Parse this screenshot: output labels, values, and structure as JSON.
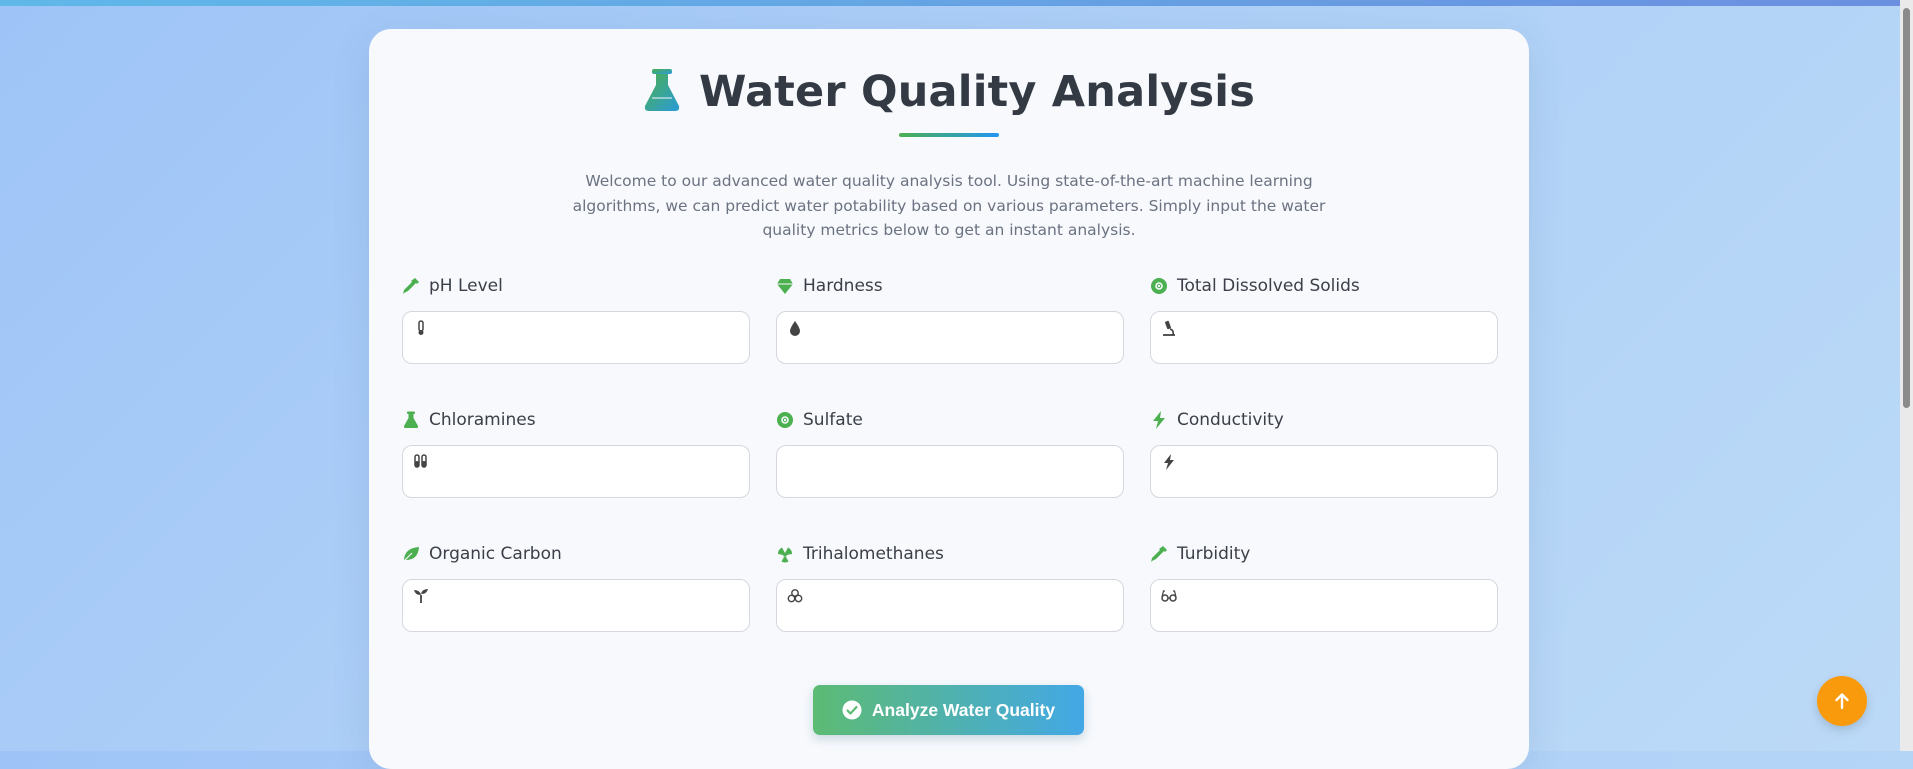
{
  "page": {
    "title": "Water Quality Analysis",
    "intro": "Welcome to our advanced water quality analysis tool. Using state-of-the-art machine learning algorithms, we can predict water potability based on various parameters. Simply input the water quality metrics below to get an instant analysis."
  },
  "fields": [
    {
      "label": "pH Level",
      "value": "",
      "label_icon": "eyedropper-icon",
      "input_icon": "thermometer-icon"
    },
    {
      "label": "Hardness",
      "value": "",
      "label_icon": "gem-icon",
      "input_icon": "droplet-icon"
    },
    {
      "label": "Total Dissolved Solids",
      "value": "",
      "label_icon": "atom-icon",
      "input_icon": "microscope-icon"
    },
    {
      "label": "Chloramines",
      "value": "",
      "label_icon": "flask-icon",
      "input_icon": "vials-icon"
    },
    {
      "label": "Sulfate",
      "value": "",
      "label_icon": "atom-icon",
      "input_icon": ""
    },
    {
      "label": "Conductivity",
      "value": "",
      "label_icon": "bolt-icon",
      "input_icon": "bolt-icon"
    },
    {
      "label": "Organic Carbon",
      "value": "",
      "label_icon": "leaf-icon",
      "input_icon": "seedling-icon"
    },
    {
      "label": "Trihalomethanes",
      "value": "",
      "label_icon": "radiation-icon",
      "input_icon": "biohazard-icon"
    },
    {
      "label": "Turbidity",
      "value": "",
      "label_icon": "eyedropper-icon",
      "input_icon": "glasses-icon"
    }
  ],
  "actions": {
    "analyze_label": "Analyze Water Quality",
    "scroll_top_icon": "arrow-up-icon"
  },
  "colors": {
    "accent_green": "#4caf50",
    "accent_blue": "#2196f3",
    "fab_orange": "#f89a0c",
    "title_text": "#333a44"
  }
}
